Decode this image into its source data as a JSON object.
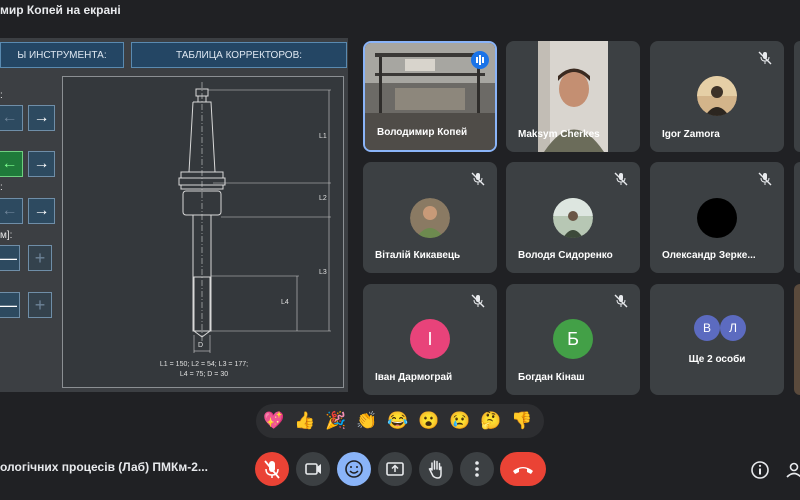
{
  "presenter_title": "мир Копей на екрані",
  "shared_screen": {
    "tab_tool": "Ы ИНСТРУМЕНТА:",
    "tab_correctors": "ТАБЛИЦА КОРРЕКТОРОВ:",
    "side_labels": [
      ":",
      ":",
      "м]:"
    ],
    "arrow_left": "←",
    "arrow_right": "→",
    "minus": "—",
    "plus": "+",
    "drawing": {
      "labels": [
        "L1",
        "L2",
        "L3",
        "L4",
        "D"
      ],
      "dims_line1": "L1 = 150;   L2 = 54;   L3 = 177;",
      "dims_line2": "L4 = 75;    D = 30"
    }
  },
  "participants": [
    {
      "name": "Володимир Копей",
      "speaking": true,
      "video": true
    },
    {
      "name": "Maksym Cherkes",
      "video": true
    },
    {
      "name": "Igor Zamora",
      "muted": true
    },
    {
      "name": "Віталій Кикавець",
      "muted": true
    },
    {
      "name": "Володя Сидоренко",
      "muted": true
    },
    {
      "name": "Олександр Зерке...",
      "muted": true
    },
    {
      "name": "Іван Дармограй",
      "muted": true,
      "initial": "І",
      "color": "#e8437a"
    },
    {
      "name": "Богдан Кінаш",
      "muted": true,
      "initial": "Б",
      "color": "#43a047"
    },
    {
      "name": "Ще 2 особи",
      "initials": [
        "В",
        "Л"
      ],
      "colors": [
        "#5c6bc0",
        "#5c6bc0"
      ]
    }
  ],
  "reactions": [
    "💖",
    "👍",
    "🎉",
    "👏",
    "😂",
    "😮",
    "😢",
    "🤔",
    "👎"
  ],
  "meeting_name": "ологічних процесів (Лаб) ПМКм-2...",
  "controls": {
    "mic_color": "#ea4335",
    "end_color": "#ea4335",
    "reaction_color": "#8ab4f8"
  }
}
